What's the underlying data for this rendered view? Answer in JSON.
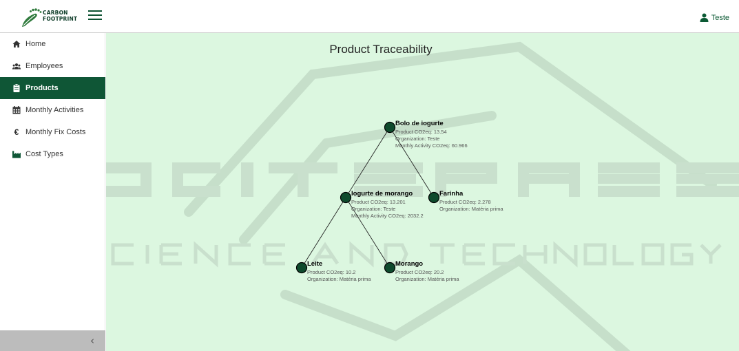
{
  "app": {
    "logo_line1": "CARBON",
    "logo_line2": "FOOTPRINT",
    "user_name": "Teste"
  },
  "sidebar": {
    "items": [
      {
        "label": "Home",
        "icon": "home-icon",
        "active": false
      },
      {
        "label": "Employees",
        "icon": "users-icon",
        "active": false
      },
      {
        "label": "Products",
        "icon": "clipboard-icon",
        "active": true
      },
      {
        "label": "Monthly Activities",
        "icon": "calendar-icon",
        "active": false
      },
      {
        "label": "Monthly Fix Costs",
        "icon": "euro-icon",
        "active": false
      },
      {
        "label": "Cost Types",
        "icon": "industry-icon",
        "active": false
      }
    ],
    "collapse_glyph": "‹"
  },
  "page": {
    "title": "Product Traceability"
  },
  "tree": {
    "nodes": [
      {
        "id": "bolo",
        "name": "Bolo de iogurte",
        "details": [
          "Product CO2eq: 13.54",
          "Organization: Teste",
          "Monthly Activity CO2eq: 60.966"
        ]
      },
      {
        "id": "iogurte",
        "parent": "bolo",
        "name": "Iogurte de morango",
        "details": [
          "Product CO2eq: 13.201",
          "Organization: Teste",
          "Monthly Activity CO2eq: 2032.2"
        ]
      },
      {
        "id": "farinha",
        "parent": "bolo",
        "name": "Farinha",
        "details": [
          "Product CO2eq: 2.278",
          "Organization: Matéria prima"
        ]
      },
      {
        "id": "leite",
        "parent": "iogurte",
        "name": "Leite",
        "details": [
          "Product CO2eq: 10.2",
          "Organization: Matéria prima"
        ]
      },
      {
        "id": "morango",
        "parent": "iogurte",
        "name": "Morango",
        "details": [
          "Product CO2eq: 20.2",
          "Organization: Matéria prima"
        ]
      }
    ]
  },
  "colors": {
    "brand": "#0f5636",
    "content_bg": "#dcf7e0",
    "node_fill": "#0e4a2c",
    "watermark": "#c4dcc8"
  }
}
